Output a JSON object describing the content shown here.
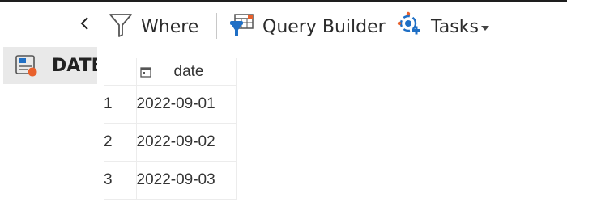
{
  "toolbar": {
    "where_label": "Where",
    "query_builder_label": "Query Builder",
    "tasks_label": "Tasks"
  },
  "table_tab": {
    "label": "DATE"
  },
  "grid": {
    "columns": [
      {
        "label": "date",
        "type_icon": "calendar-icon"
      }
    ],
    "rows": [
      {
        "num": "1",
        "date": "2022-09-01"
      },
      {
        "num": "2",
        "date": "2022-09-02"
      },
      {
        "num": "3",
        "date": "2022-09-03"
      }
    ]
  },
  "colors": {
    "accent_blue": "#1f6fc5",
    "accent_orange": "#e8612c",
    "tab_background": "#e9e9e9"
  }
}
